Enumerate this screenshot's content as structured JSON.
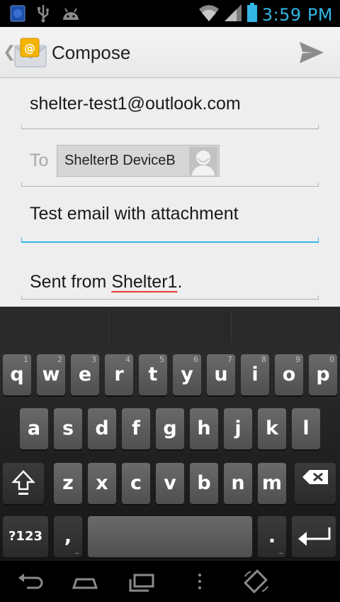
{
  "status_bar": {
    "time": "3:59 PM",
    "icons": [
      "sim-notification-icon",
      "usb-icon",
      "android-debug-icon",
      "wifi-icon",
      "signal-icon",
      "battery-icon"
    ]
  },
  "action_bar": {
    "title": "Compose",
    "app_icon": "email-app-icon",
    "send_icon": "send-icon"
  },
  "compose": {
    "from": "shelter-test1@outlook.com",
    "to_label": "To",
    "to_chip": "ShelterB DeviceB",
    "subject": "Test email with attachment",
    "body_prefix": "Sent from ",
    "body_word": "Shelter1",
    "body_suffix": "."
  },
  "keyboard": {
    "row1": [
      {
        "key": "q",
        "hint": "1"
      },
      {
        "key": "w",
        "hint": "2"
      },
      {
        "key": "e",
        "hint": "3"
      },
      {
        "key": "r",
        "hint": "4"
      },
      {
        "key": "t",
        "hint": "5"
      },
      {
        "key": "y",
        "hint": "6"
      },
      {
        "key": "u",
        "hint": "7"
      },
      {
        "key": "i",
        "hint": "8"
      },
      {
        "key": "o",
        "hint": "9"
      },
      {
        "key": "p",
        "hint": "0"
      }
    ],
    "row2": [
      "a",
      "s",
      "d",
      "f",
      "g",
      "h",
      "j",
      "k",
      "l"
    ],
    "row3": [
      "z",
      "x",
      "c",
      "v",
      "b",
      "n",
      "m"
    ],
    "symbols_key": "?123",
    "comma_key": ",",
    "period_key": ".",
    "colors": {
      "key": "#5a5a5a",
      "accent": "#33b5e5"
    }
  },
  "nav_bar": {
    "buttons": [
      "back-icon",
      "home-icon",
      "recents-icon",
      "menu-icon",
      "rotate-icon"
    ]
  }
}
